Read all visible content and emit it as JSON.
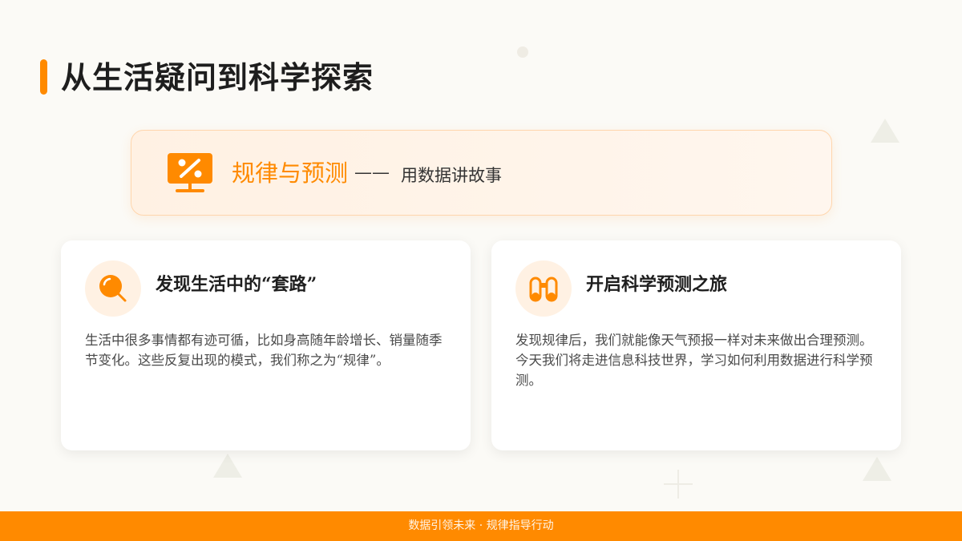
{
  "page": {
    "title": "从生活疑问到科学探索",
    "accent_color": "#ff8a00"
  },
  "banner": {
    "icon": "percent-board-icon",
    "heading": "规律与预测",
    "dash": "——",
    "subtitle": "用数据讲故事"
  },
  "cards": [
    {
      "icon": "magnifier-icon",
      "title": "发现生活中的“套路”",
      "body": "生活中很多事情都有迹可循，比如身高随年龄增长、销量随季节变化。这些反复出现的模式，我们称之为“规律”。"
    },
    {
      "icon": "binoculars-icon",
      "title": "开启科学预测之旅",
      "body": "发现规律后，我们就能像天气预报一样对未来做出合理预测。今天我们将走进信息科技世界，学习如何利用数据进行科学预测。"
    }
  ],
  "footer": {
    "text": "数据引领未来 · 规律指导行动"
  }
}
